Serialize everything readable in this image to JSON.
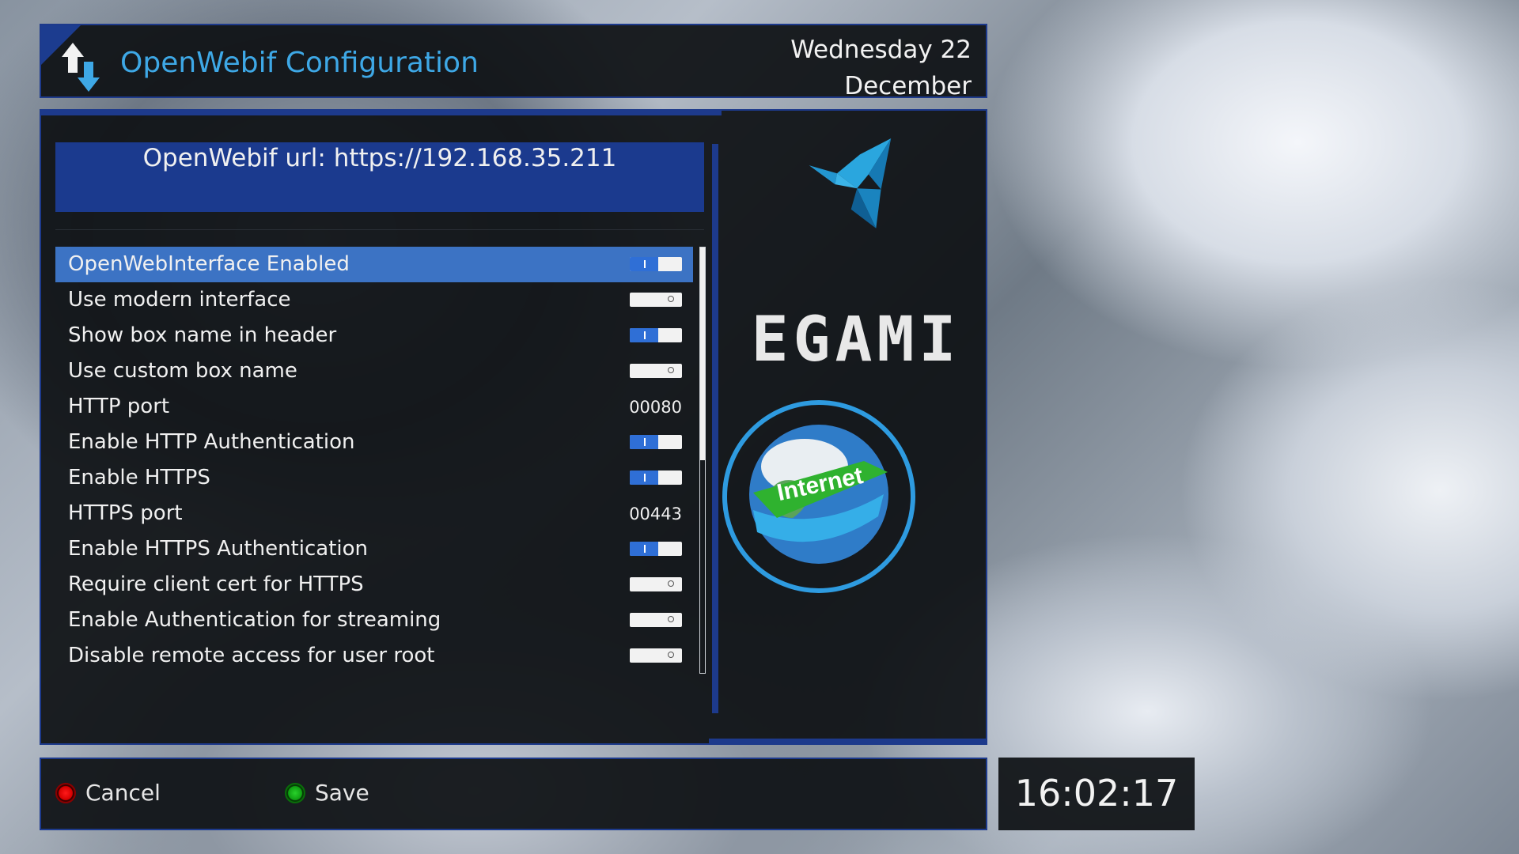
{
  "header": {
    "title": "OpenWebif Configuration",
    "date_line1": "Wednesday 22",
    "date_line2": "December"
  },
  "url_box": {
    "text": "OpenWebif url: https://192.168.35.211"
  },
  "settings": [
    {
      "label": "OpenWebInterface Enabled",
      "type": "toggle",
      "enabled": true,
      "selected": true
    },
    {
      "label": "Use modern interface",
      "type": "toggle",
      "enabled": false
    },
    {
      "label": "Show box name in header",
      "type": "toggle",
      "enabled": true
    },
    {
      "label": "Use custom box name",
      "type": "toggle",
      "enabled": false
    },
    {
      "label": "HTTP port",
      "type": "value",
      "value": "00080"
    },
    {
      "label": "Enable HTTP Authentication",
      "type": "toggle",
      "enabled": true
    },
    {
      "label": "Enable HTTPS",
      "type": "toggle",
      "enabled": true
    },
    {
      "label": "HTTPS port",
      "type": "value",
      "value": "00443"
    },
    {
      "label": "Enable HTTPS Authentication",
      "type": "toggle",
      "enabled": true
    },
    {
      "label": "Require client cert for HTTPS",
      "type": "toggle",
      "enabled": false
    },
    {
      "label": "Enable Authentication for streaming",
      "type": "toggle",
      "enabled": false
    },
    {
      "label": "Disable remote access for user root",
      "type": "toggle",
      "enabled": false
    }
  ],
  "scroll": {
    "position": 0,
    "visible_fraction": 0.5
  },
  "brand": {
    "name": "EGAMI",
    "globe_text": "Internet"
  },
  "buttons": {
    "cancel_label": "Cancel",
    "save_label": "Save"
  },
  "clock": "16:02:17",
  "colors": {
    "accent": "#1d3a8c",
    "title_text": "#3ea8e6",
    "selected_row": "#3c73c4",
    "toggle_on": "#2f6fd6",
    "red_button": "#e00000",
    "green_button": "#12a512"
  }
}
